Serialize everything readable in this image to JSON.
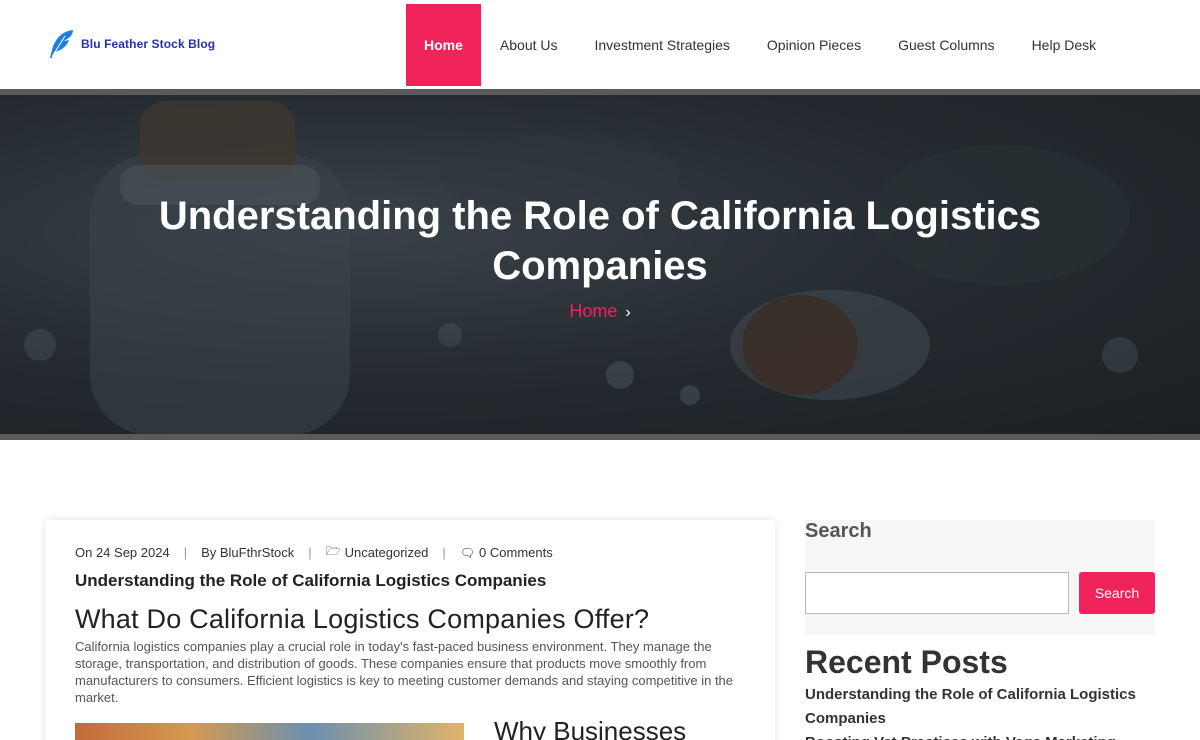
{
  "site": {
    "name": "Blu Feather Stock Blog",
    "accent": "#f0235a"
  },
  "nav": {
    "items": [
      {
        "label": "Home",
        "active": true
      },
      {
        "label": "About Us"
      },
      {
        "label": "Investment Strategies"
      },
      {
        "label": "Opinion Pieces"
      },
      {
        "label": "Guest Columns"
      },
      {
        "label": "Help Desk"
      }
    ]
  },
  "hero": {
    "title": "Understanding the Role of California Logistics Companies",
    "breadcrumb": "Home"
  },
  "post": {
    "date": "On 24 Sep 2024",
    "author": "By BluFthrStock",
    "category": "Uncategorized",
    "comments": "0 Comments",
    "title": "Understanding the Role of California Logistics Companies",
    "heading": "What Do California Logistics Companies Offer?",
    "paragraph": "California logistics companies play a crucial role in today's fast-paced business environment. They manage the storage, transportation, and distribution of goods. These companies ensure that products move smoothly from manufacturers to consumers. Efficient logistics is key to meeting customer demands and staying competitive in the market.",
    "subheading": "Why Businesses"
  },
  "sidebar": {
    "search_title": "Search",
    "search_button": "Search",
    "search_placeholder": "",
    "recent_title": "Recent Posts",
    "recent_posts": [
      "Understanding the Role of California Logistics Companies",
      "Boosting Vet Practices with Vega Marketing"
    ]
  }
}
